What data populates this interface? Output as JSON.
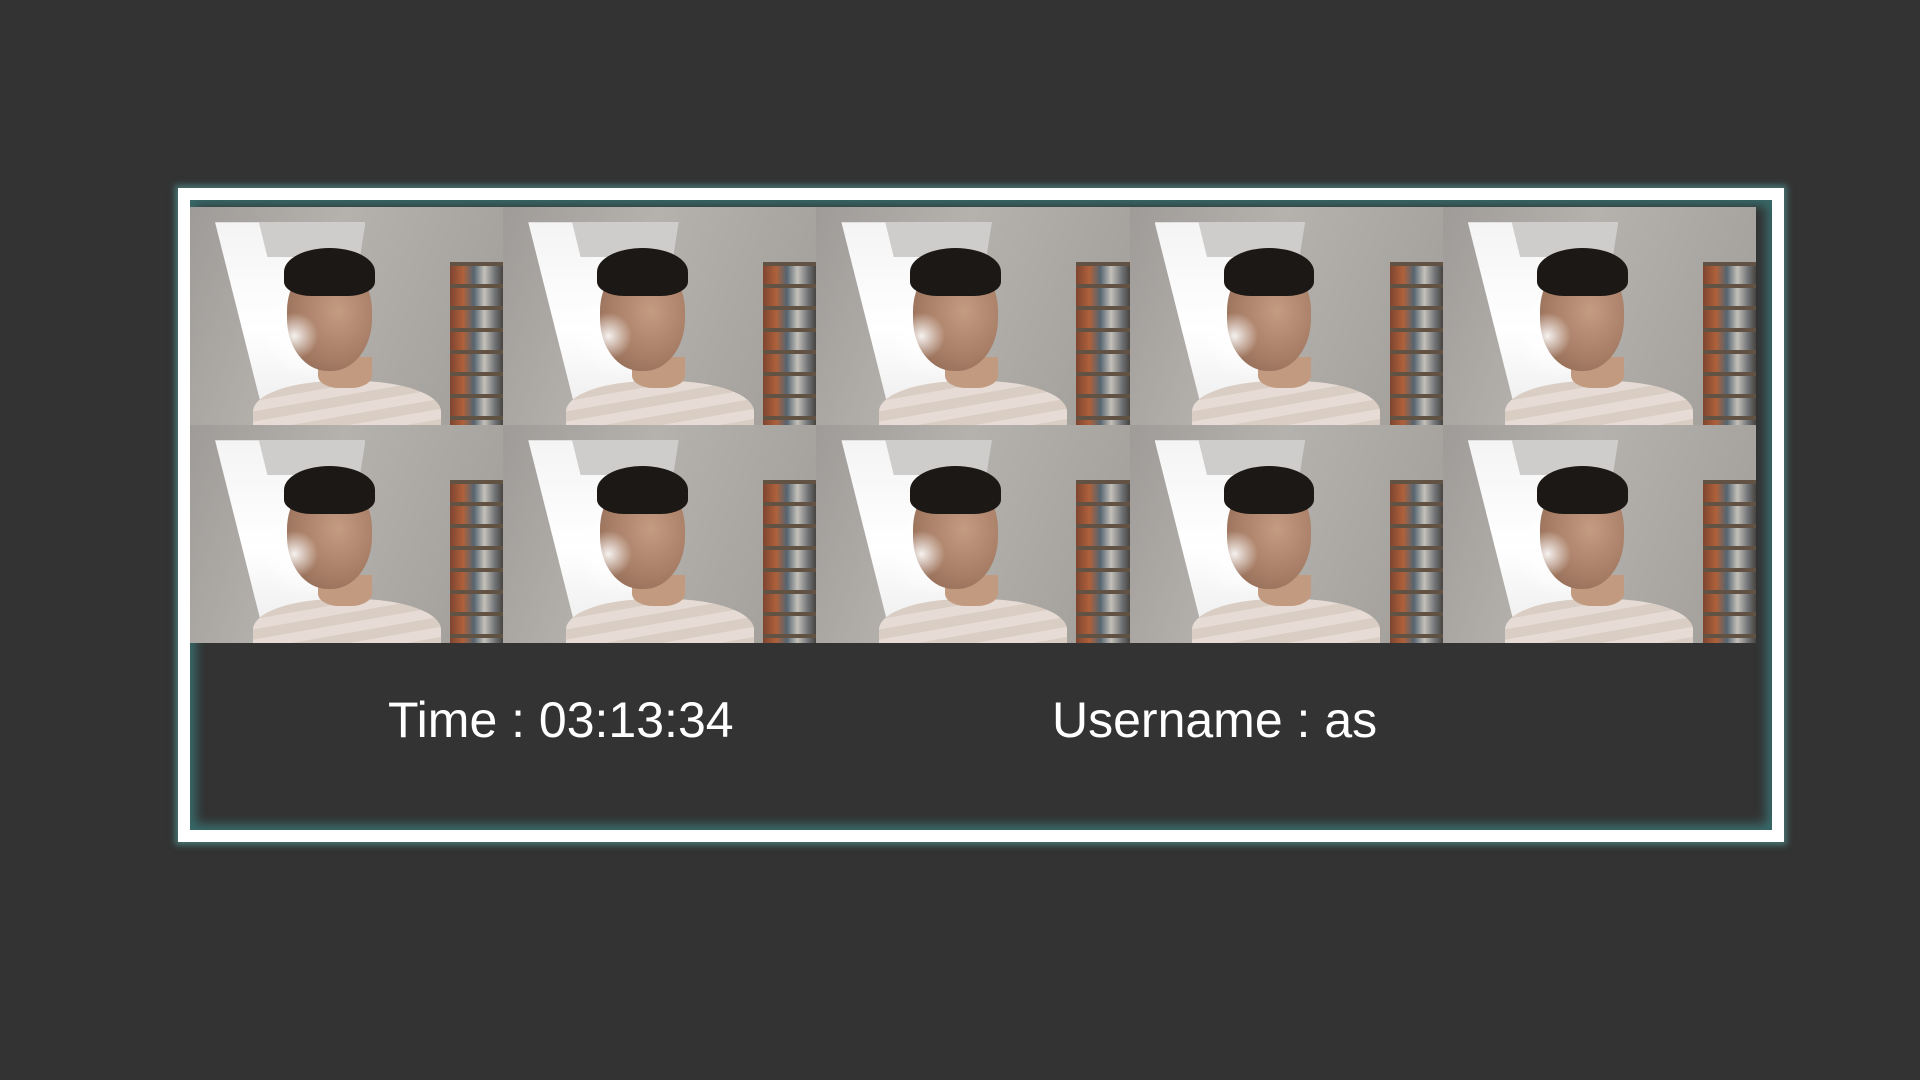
{
  "frame": {
    "accent_color": "#5aaaaa",
    "border_color": "#ffffff",
    "background": "#333333"
  },
  "snapshots": [
    {
      "alt": "webcam snapshot 1"
    },
    {
      "alt": "webcam snapshot 2"
    },
    {
      "alt": "webcam snapshot 3"
    },
    {
      "alt": "webcam snapshot 4"
    },
    {
      "alt": "webcam snapshot 5"
    },
    {
      "alt": "webcam snapshot 6"
    },
    {
      "alt": "webcam snapshot 7"
    },
    {
      "alt": "webcam snapshot 8"
    },
    {
      "alt": "webcam snapshot 9"
    },
    {
      "alt": "webcam snapshot 10"
    }
  ],
  "info": {
    "time_text": "Time : 03:13:34",
    "username_text": "Username : as"
  }
}
